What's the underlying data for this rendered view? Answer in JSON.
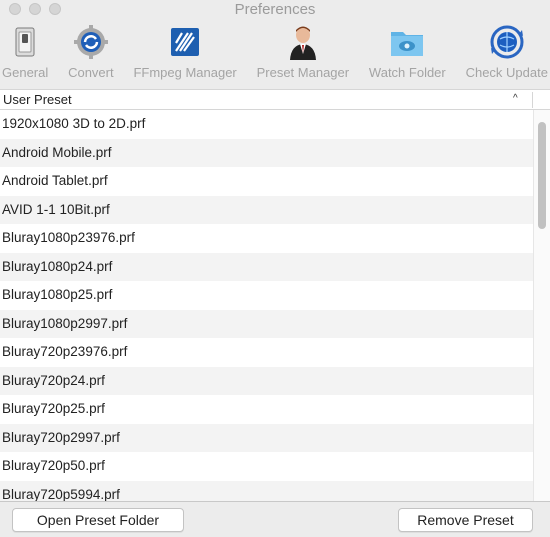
{
  "window": {
    "title": "Preferences"
  },
  "toolbar": {
    "items": [
      {
        "label": "General",
        "icon": "switch-icon"
      },
      {
        "label": "Convert",
        "icon": "gear-icon"
      },
      {
        "label": "FFmpeg Manager",
        "icon": "ffmpeg-icon"
      },
      {
        "label": "Preset Manager",
        "icon": "person-icon"
      },
      {
        "label": "Watch Folder",
        "icon": "eye-folder-icon"
      },
      {
        "label": "Check Update",
        "icon": "sync-globe-icon"
      }
    ]
  },
  "table": {
    "header": "User Preset",
    "sort_indicator": "^",
    "rows": [
      "1920x1080 3D to 2D.prf",
      "Android Mobile.prf",
      "Android Tablet.prf",
      "AVID 1-1 10Bit.prf",
      "Bluray1080p23976.prf",
      "Bluray1080p24.prf",
      "Bluray1080p25.prf",
      "Bluray1080p2997.prf",
      "Bluray720p23976.prf",
      "Bluray720p24.prf",
      "Bluray720p25.prf",
      "Bluray720p2997.prf",
      "Bluray720p50.prf",
      "Bluray720p5994.prf"
    ]
  },
  "buttons": {
    "open_folder": "Open Preset Folder",
    "remove": "Remove Preset"
  },
  "colors": {
    "accent": "#1e6fd0",
    "toolbar_label": "#a4a4a4"
  }
}
